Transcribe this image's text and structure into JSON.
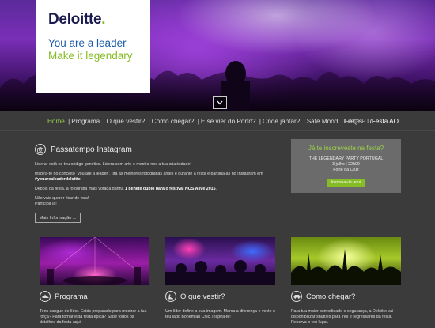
{
  "brand": {
    "logo": "Deloitte",
    "logo_dot": ".",
    "tagline_1": "You are a leader",
    "tagline_2": "Make it legendary",
    "green": "#86bc25",
    "blue": "#1a5aa8"
  },
  "hero": {
    "scroll_icon": "chevron-down-icon"
  },
  "nav": {
    "items": [
      "Home",
      "Programa",
      "O que vestir?",
      "Como chegar?",
      "E se vier do Porto?",
      "Onde jantar?",
      "Safe Mood",
      "FAQ's"
    ],
    "separator": "|",
    "lang_pt": "Festa PT",
    "lang_sep": "/",
    "lang_ao": "Festa AO"
  },
  "instagram": {
    "icon": "camera-icon",
    "title": "Passatempo Instagram",
    "p1": "Liderar está no teu código genético. Lidera com arte e mostra-nos a tua criatividade!",
    "p2": "Inspira-te no conceito \"you are a leader\", tira as melhores fotografias antes e durante a festa e partilha-as no Instagram em",
    "hashtag": "#youarealeaderdeloitte",
    "p3_pre": "Depois da festa, a fotografia mais votada ganha ",
    "p3_bold": "1 bilhete duplo para o festival NOS Alive 2015",
    "p3_post": ".",
    "p4": "Não vais querer ficar de fora!",
    "p5": "Participa já!",
    "more_label": "Mais Informação ..."
  },
  "register": {
    "title": "Já te inscreveste na festa?",
    "line1": "THE LEGENDARY PARTY PORTUGAL",
    "line2": "3 julho | 22h00",
    "line3": "Forte da Cruz",
    "button": "Inscreve-te aqui"
  },
  "cards": [
    {
      "icon": "sneaker-icon",
      "title": "Programa",
      "desc": "Tens sangue de líder. Estás preparado para mostrar a tua força? Para tornar esta festa épica? Sabe todos os detalhes da festa aqui."
    },
    {
      "icon": "shoe-icon",
      "title": "O que vestir?",
      "desc": "Um líder define a sua imagem. Marca a diferença e veste o teu lado Bohemian Chic. Inspira-te!"
    },
    {
      "icon": "car-icon",
      "title": "Como chegar?",
      "desc": "Para tua maior comodidade e segurança, a Deloitte vai disponibilizar shuttles para ires e regressares da festa. Reserva o teu lugar."
    }
  ]
}
